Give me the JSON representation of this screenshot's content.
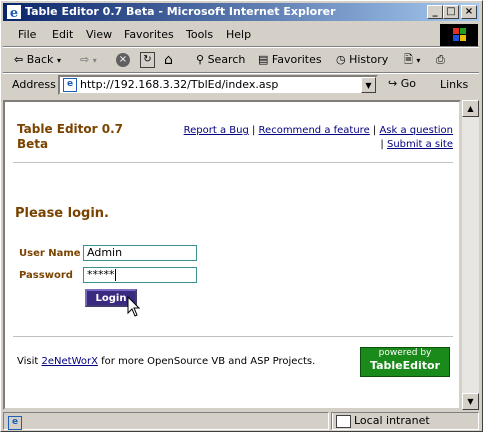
{
  "window": {
    "title": "Table Editor 0.7 Beta - Microsoft Internet Explorer"
  },
  "menu": [
    "File",
    "Edit",
    "View",
    "Favorites",
    "Tools",
    "Help"
  ],
  "toolbar": {
    "back": "Back",
    "search": "Search",
    "favorites": "Favorites",
    "history": "History"
  },
  "address": {
    "label": "Address",
    "url": "http://192.168.3.32/TblEd/index.asp",
    "go": "Go",
    "links": "Links"
  },
  "page": {
    "app_title_line1": "Table Editor 0.7",
    "app_title_line2": "Beta",
    "nav_links": [
      "Report a Bug",
      "Recommend a feature",
      "Ask a question",
      "Submit a site"
    ],
    "login_heading": "Please login.",
    "username_label": "User Name",
    "username_value": "Admin",
    "password_label": "Password",
    "password_value": "*****",
    "login_button": "Login",
    "footer_prefix": "Visit",
    "footer_link": "2eNetWorX",
    "footer_suffix": "for more OpenSource VB and ASP Projects.",
    "badge_line1": "powered by",
    "badge_line2": "TableEditor"
  },
  "status": {
    "zone": "Local intranet"
  },
  "colors": {
    "title_start": "#0a246a",
    "title_end": "#a6caf0",
    "accent_brown": "#7a4300",
    "badge_green": "#1a8a1a",
    "link": "#000080"
  }
}
